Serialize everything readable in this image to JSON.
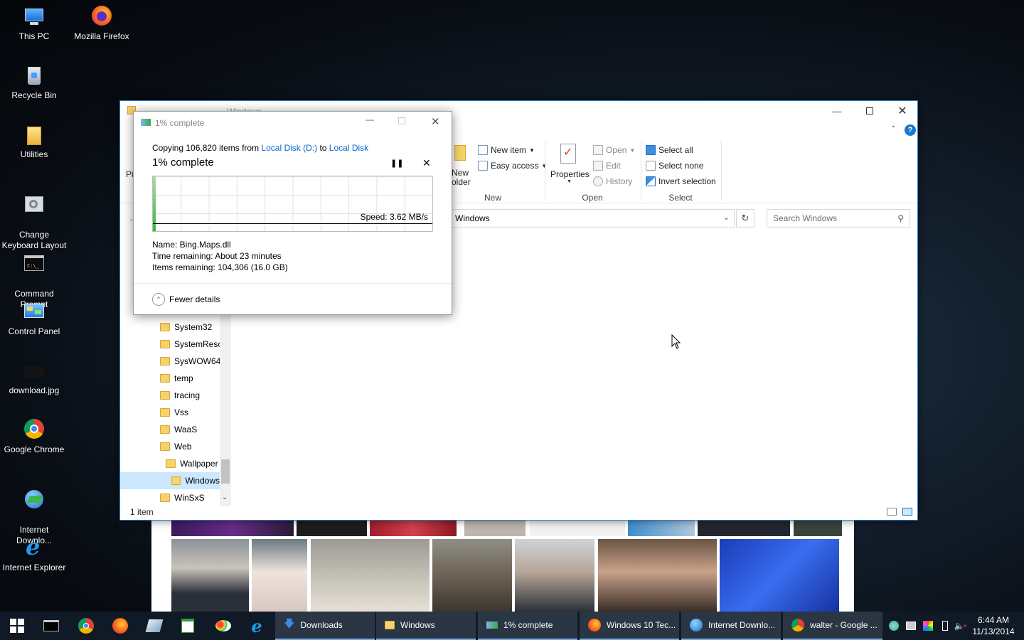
{
  "desktop": {
    "icons": [
      {
        "label": "This PC"
      },
      {
        "label": "Mozilla Firefox"
      },
      {
        "label": "Recycle Bin"
      },
      {
        "label": "Utilities"
      },
      {
        "label": "Change\nKeyboard Layout"
      },
      {
        "label": "Command\nPrompt"
      },
      {
        "label": "Control Panel"
      },
      {
        "label": "download.jpg"
      },
      {
        "label": "Google Chrome"
      },
      {
        "label": "Internet\nDownlo..."
      },
      {
        "label": "Internet Explorer"
      }
    ]
  },
  "explorer": {
    "title": "Windows",
    "ribbon": {
      "new_group": {
        "label": "New",
        "new_folder": "New\nolder",
        "new_item": "New item",
        "easy_access": "Easy access"
      },
      "open_group": {
        "label": "Open",
        "properties": "Properties",
        "open": "Open",
        "edit": "Edit",
        "history": "History"
      },
      "select_group": {
        "label": "Select",
        "select_all": "Select all",
        "select_none": "Select none",
        "invert_selection": "Invert selection"
      },
      "pin_partial": "Pi"
    },
    "address": "Windows",
    "search_placeholder": "Search Windows",
    "tree": [
      {
        "label": "System32"
      },
      {
        "label": "SystemReso"
      },
      {
        "label": "SysWOW64"
      },
      {
        "label": "temp"
      },
      {
        "label": "tracing"
      },
      {
        "label": "Vss"
      },
      {
        "label": "WaaS"
      },
      {
        "label": "Web"
      },
      {
        "label": "Wallpaper"
      },
      {
        "label": "Windows"
      },
      {
        "label": "WinSxS"
      }
    ],
    "status": "1 item"
  },
  "copy_dialog": {
    "title": "1% complete",
    "copying_prefix": "Copying 106,820 items from ",
    "source": "Local Disk (D:)",
    "to_word": " to ",
    "destination": "Local Disk",
    "percent_label": "1% complete",
    "progress_percent": 1,
    "speed": "Speed: 3.62 MB/s",
    "name_line": "Name:  Bing.Maps.dll",
    "time_line": "Time remaining:  About 23 minutes",
    "items_line": "Items remaining:  104,306 (16.0 GB)",
    "fewer_details": "Fewer details"
  },
  "taskbar": {
    "tasks": [
      {
        "label": "Downloads"
      },
      {
        "label": "Windows"
      },
      {
        "label": "1% complete"
      },
      {
        "label": "Windows 10 Tec..."
      },
      {
        "label": "Internet Downlo..."
      },
      {
        "label": "walter - Google ..."
      }
    ],
    "time": "6:44 AM",
    "date": "11/13/2014"
  },
  "colors": {
    "accent": "#0078d7",
    "link": "#0066cc",
    "folder": "#f6d26b",
    "taskbar": "#0f1a26"
  }
}
